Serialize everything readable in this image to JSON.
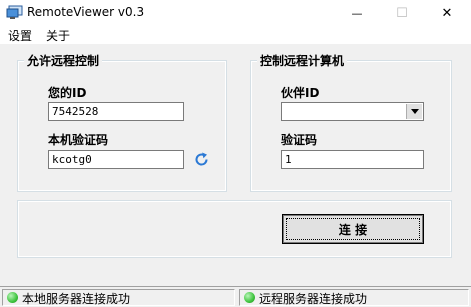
{
  "window": {
    "title": "RemoteViewer v0.3",
    "minimize_glyph": "—",
    "maximize_glyph": "☐",
    "close_glyph": "✕"
  },
  "menu": {
    "items": [
      {
        "label": "设置"
      },
      {
        "label": "关于"
      }
    ]
  },
  "allow_group": {
    "caption": "允许远程控制",
    "your_id_label": "您的ID",
    "your_id_value": "7542528",
    "password_label": "本机验证码",
    "password_value": "kcotg0",
    "refresh_icon": "refresh-icon"
  },
  "control_group": {
    "caption": "控制远程计算机",
    "partner_id_label": "伙伴ID",
    "partner_id_value": "",
    "password_label": "验证码",
    "password_value": "1"
  },
  "connect_button": {
    "label": "连 接"
  },
  "status": {
    "local": {
      "text": "本地服务器连接成功",
      "color": "#3ec43e"
    },
    "remote": {
      "text": "远程服务器连接成功",
      "color": "#3ec43e"
    }
  },
  "colors": {
    "accent_icon": "#2b79d4",
    "window_bg": "#f0f0f0"
  }
}
